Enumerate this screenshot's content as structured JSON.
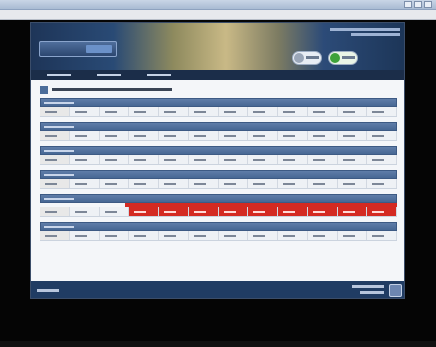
{
  "window": {
    "title_bar_text": "",
    "menu_items": [
      "",
      "",
      "",
      "",
      "",
      "",
      ""
    ]
  },
  "app": {
    "header_buttons": [
      "",
      ""
    ],
    "nav_tabs": [
      "",
      "",
      ""
    ],
    "page_heading": "",
    "sections": [
      {
        "header": "",
        "cells": 12,
        "alarm": false
      },
      {
        "header": "",
        "cells": 12,
        "alarm": false
      },
      {
        "header": "",
        "cells": 12,
        "alarm": false
      },
      {
        "header": "",
        "cells": 12,
        "alarm": false
      },
      {
        "header": "",
        "cells": 12,
        "alarm": true
      },
      {
        "header": "",
        "cells": 12,
        "alarm": false
      }
    ],
    "status_text": "",
    "copyright_text": ""
  },
  "colors": {
    "header_blue": "#476793",
    "alarm_red": "#d42a22",
    "ok_green": "#3ea23a",
    "status_navy": "#203c63"
  },
  "icons": [
    "window-buttons-icon",
    "home-icon",
    "refresh-icon",
    "section-icon",
    "logo-icon"
  ]
}
